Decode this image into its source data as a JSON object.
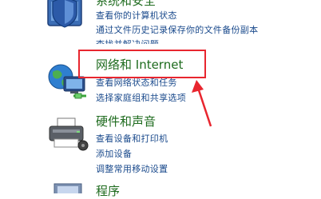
{
  "categories": [
    {
      "title": "系统和安全",
      "icon": "shield-computer-icon",
      "links": [
        "查看你的计算机状态",
        "通过文件历史记录保存你的文件备份副本",
        "查找并解决问题"
      ]
    },
    {
      "title": "网络和 Internet",
      "icon": "network-globe-icon",
      "links": [
        "查看网络状态和任务",
        "选择家庭组和共享选项"
      ]
    },
    {
      "title": "硬件和声音",
      "icon": "printer-icon",
      "links": [
        "查看设备和打印机",
        "添加设备",
        "调整常用移动设置"
      ]
    },
    {
      "title": "程序",
      "icon": "programs-icon",
      "links": []
    }
  ],
  "annotation": {
    "highlight_color": "#e8262f"
  }
}
